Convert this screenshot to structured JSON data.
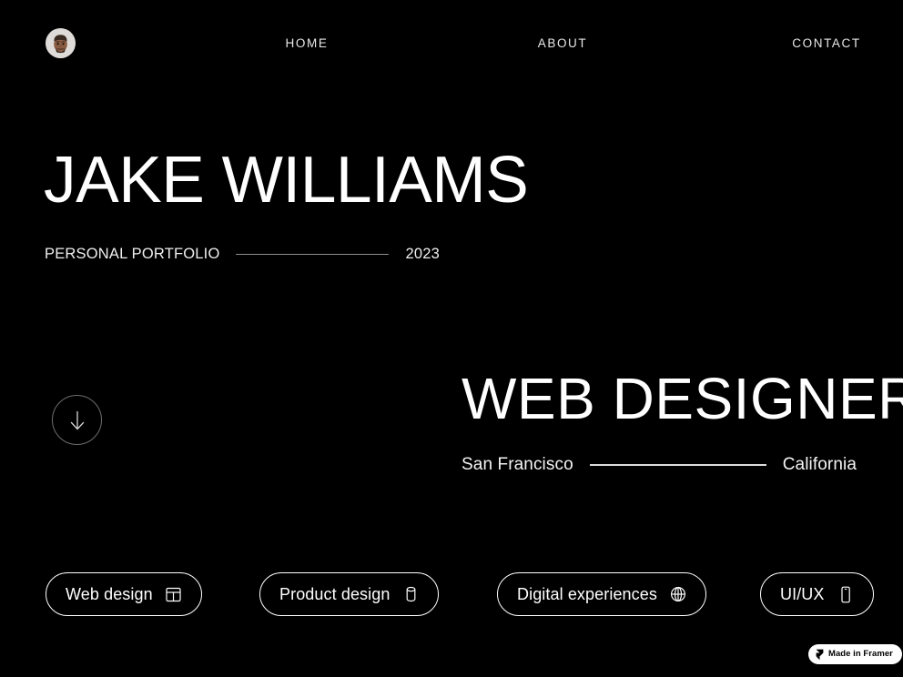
{
  "theme": {
    "background": "#000000",
    "foreground": "#ffffff",
    "rule_dim": "#8e8e8e",
    "rule_bright": "#dcdcdc",
    "avatar_bg": "#dedbd8",
    "scroll_ring": "#6d6d6d",
    "badge_bg": "#ffffff",
    "badge_fg": "#000000"
  },
  "nav": {
    "logo": {
      "icon": "avatar-face-icon",
      "alt": "Jake Williams avatar"
    },
    "links": [
      {
        "label": "HOME"
      },
      {
        "label": "ABOUT"
      },
      {
        "label": "CONTACT"
      }
    ]
  },
  "hero": {
    "name": "JAKE WILLIAMS",
    "meta_left": "PERSONAL PORTFOLIO",
    "meta_right": "2023",
    "role": "WEB DESIGNER",
    "location_city": "San Francisco",
    "location_state": "California",
    "scroll_button": {
      "icon": "arrow-down-icon",
      "label": "Scroll down"
    }
  },
  "services": [
    {
      "label": "Web design",
      "icon": "layout-panels-icon"
    },
    {
      "label": "Product design",
      "icon": "cylinder-database-icon"
    },
    {
      "label": "Digital experiences",
      "icon": "globe-icon"
    },
    {
      "label": "UI/UX",
      "icon": "mobile-phone-icon"
    }
  ],
  "framer_badge": {
    "label": "Made in Framer",
    "icon": "framer-logo-icon"
  }
}
